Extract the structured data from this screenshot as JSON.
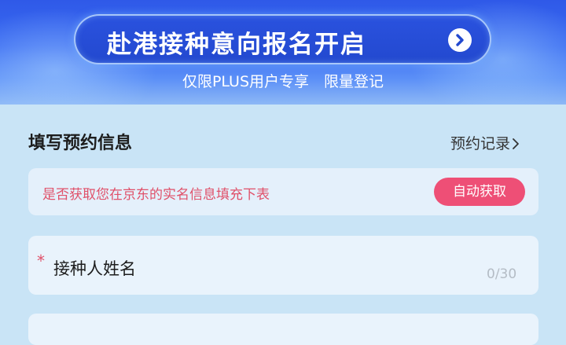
{
  "banner": {
    "headline": "",
    "cta_label": "赴港接种意向报名开启",
    "subline": "仅限PLUS用户专享　限量登记",
    "colors": {
      "banner_blue": "#2f59e8",
      "pill_blue": "#2349cf"
    },
    "cta_icon": "chevron-right-circle-icon"
  },
  "form": {
    "section_title": "填写预约信息",
    "records_link": "预约记录",
    "records_icon": "chevron-right-icon",
    "realname_prompt": "是否获取您在京东的实名信息填充下表",
    "auto_fill_button": "自动获取",
    "accent_color": "#ee4f76",
    "name_field": {
      "required_mark": "*",
      "label": "接种人姓名",
      "counter": "0/30"
    }
  }
}
